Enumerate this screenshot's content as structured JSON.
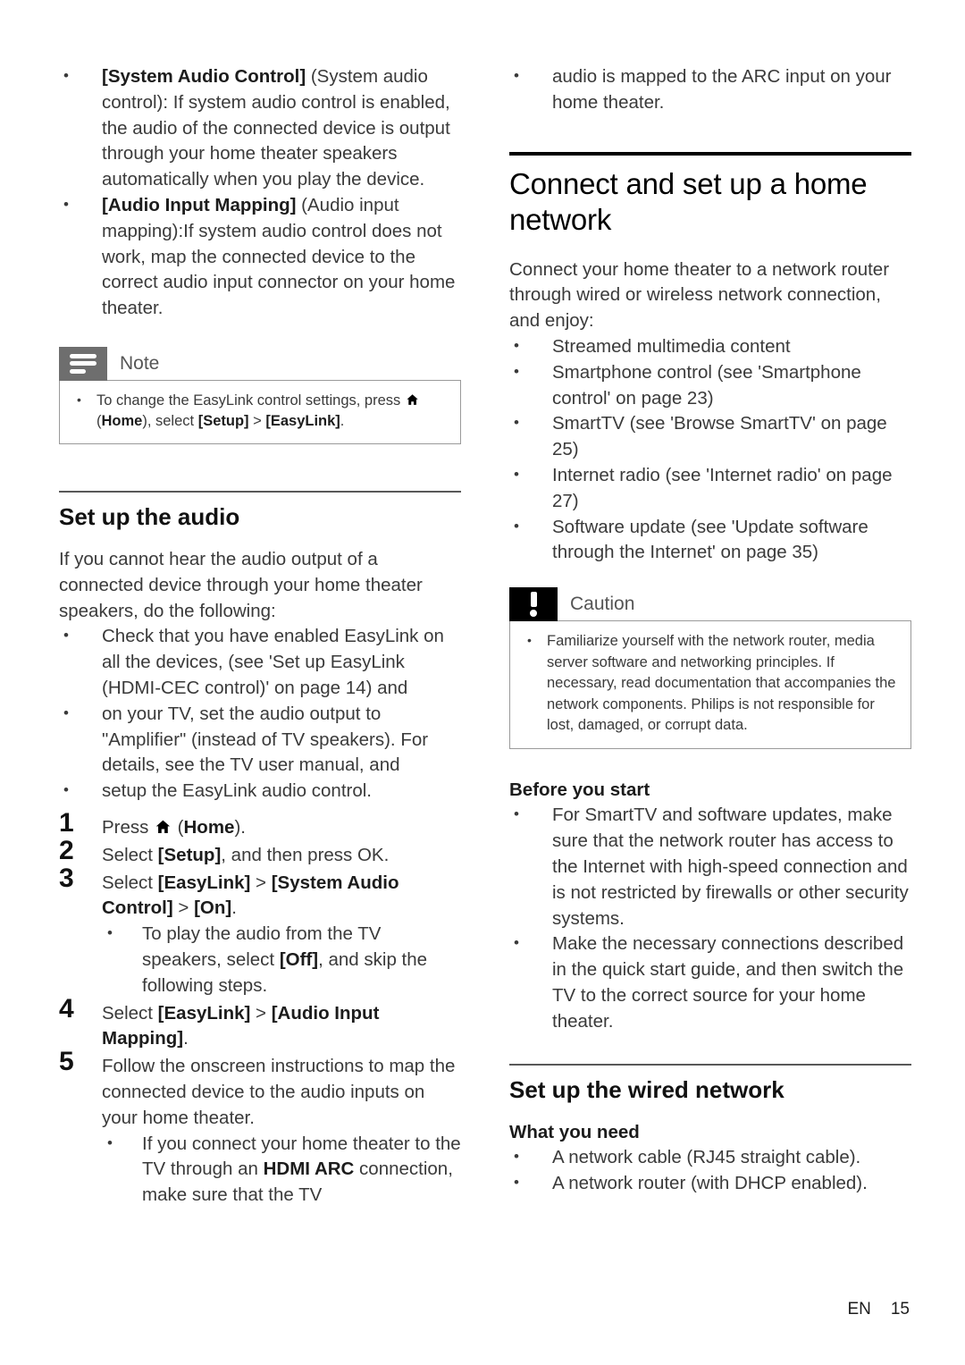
{
  "document": {
    "footer": {
      "language": "EN",
      "page_number": "15"
    }
  },
  "left_column": {
    "top_bullets": [
      {
        "bold_lead": "[System Audio Control]",
        "rest": " (System audio control): If system audio control is enabled, the audio of the connected device is output through your home theater speakers automatically when you play the device."
      },
      {
        "bold_lead": "[Audio Input Mapping]",
        "rest": " (Audio input mapping):If system audio control does not work, map the connected device to the correct audio input connector on your home theater."
      }
    ],
    "note_box": {
      "label": "Note",
      "icon": "note-lines-icon",
      "bullet_prefix": "To change the EasyLink control settings, press ",
      "home_icon": "home-icon",
      "bullet_suffix_plain_1": " (",
      "bullet_home_word": "Home",
      "bullet_suffix_plain_2": "), select ",
      "bullet_bold_1": "[Setup]",
      "bullet_sep": " > ",
      "bullet_bold_2": "[EasyLink]",
      "bullet_end": "."
    },
    "section": {
      "heading": "Set up the audio",
      "intro": "If you cannot hear the audio output of a connected device through your home theater speakers, do the following:",
      "bullets": [
        "Check that you have enabled EasyLink on all the devices, (see 'Set up EasyLink (HDMI-CEC control)' on page 14) and",
        "on your TV, set the audio output to \"Amplifier\" (instead of TV speakers). For details, see the TV user manual, and",
        "setup the EasyLink audio control."
      ],
      "steps": [
        {
          "number": "1",
          "prefix": "Press ",
          "icon": "home-icon",
          "middle": " (",
          "bold": "Home",
          "suffix": ")."
        },
        {
          "number": "2",
          "prefix": "Select ",
          "bold": "[Setup]",
          "suffix": ", and then press OK."
        },
        {
          "number": "3",
          "prefix": "Select ",
          "bold1": "[EasyLink]",
          "sep": " > ",
          "bold2": "[System Audio Control]",
          "sep2": " > ",
          "bold3": "[On]",
          "suffix": ".",
          "subbullets": [
            {
              "prefix": "To play the audio from the TV speakers, select ",
              "bold": "[Off]",
              "suffix": ", and skip the following steps."
            }
          ]
        },
        {
          "number": "4",
          "prefix": "Select ",
          "bold1": "[EasyLink]",
          "sep": " > ",
          "bold2": "[Audio Input Mapping]",
          "suffix": "."
        },
        {
          "number": "5",
          "prefix": "Follow the onscreen instructions to map the connected device to the audio inputs on your home theater.",
          "subbullets": [
            {
              "prefix": "If you connect your home theater to the TV through an ",
              "bold": "HDMI ARC",
              "suffix": " connection, make sure that the TV"
            }
          ]
        }
      ]
    }
  },
  "right_column": {
    "continuation": "audio is mapped to the ARC input on your home theater.",
    "title": "Connect and set up a home network",
    "intro": "Connect your home theater to a network router through wired or wireless network connection, and enjoy:",
    "feature_bullets": [
      "Streamed multimedia content",
      "Smartphone control (see 'Smartphone control' on page 23)",
      "SmartTV (see 'Browse SmartTV' on page 25)",
      "Internet radio (see 'Internet radio' on page 27)",
      "Software update (see 'Update software through the Internet' on page 35)"
    ],
    "caution_box": {
      "label": "Caution",
      "icon": "exclamation-icon",
      "bullets": [
        "Familiarize yourself with the network router, media server software and networking principles. If necessary, read documentation that accompanies the network components. Philips is not responsible for lost, damaged, or corrupt data."
      ]
    },
    "before_you_start": {
      "heading": "Before you start",
      "bullets": [
        "For SmartTV and software updates, make sure that the network router has access to the Internet with high-speed connection and is not restricted by firewalls or other security systems.",
        "Make the necessary connections described in the quick start guide, and then switch the TV to the correct source for your home theater."
      ]
    },
    "wired_section": {
      "heading": "Set up the wired network",
      "subheading": "What you need",
      "bullets": [
        "A network cable (RJ45 straight cable).",
        "A network router (with DHCP enabled)."
      ]
    }
  }
}
